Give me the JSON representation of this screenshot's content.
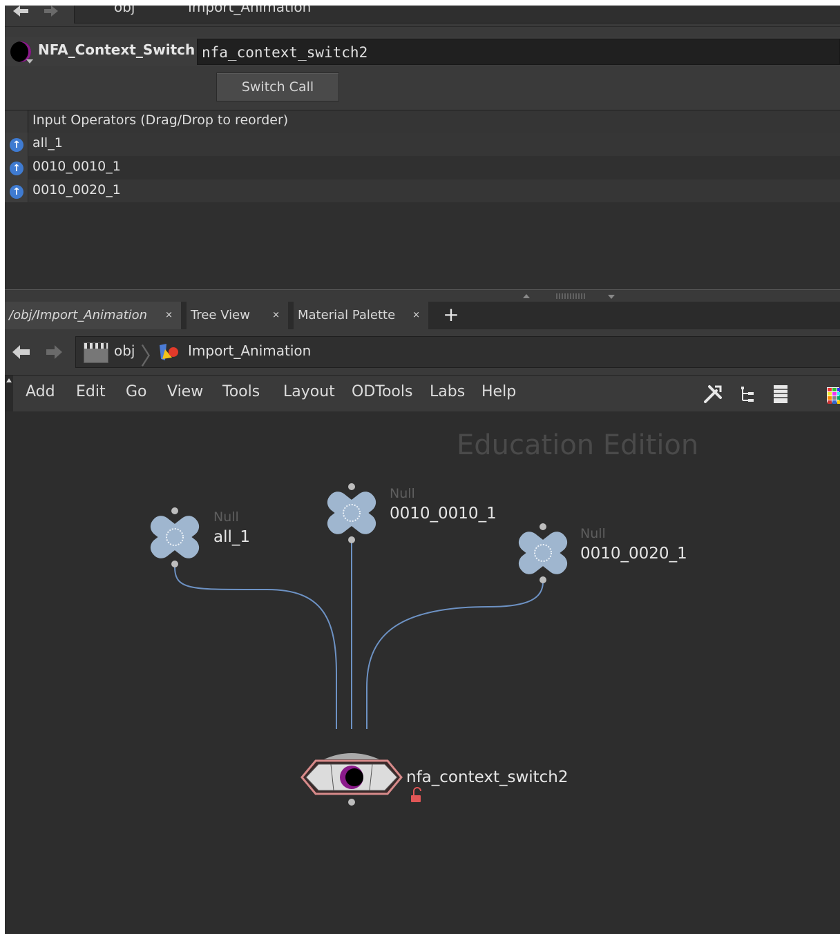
{
  "top_path": {
    "obj": "obj",
    "current": "Import_Animation"
  },
  "node_header": {
    "type_label": "NFA_Context_Switch",
    "name_value": "nfa_context_switch2"
  },
  "buttons": {
    "switch_call": "Switch Call"
  },
  "input_operators": {
    "header": "Input Operators (Drag/Drop to reorder)",
    "rows": [
      "all_1",
      "0010_0010_1",
      "0010_0020_1"
    ]
  },
  "tabs": [
    {
      "label": "/obj/Import_Animation",
      "close": "×"
    },
    {
      "label": "Tree View",
      "close": "×"
    },
    {
      "label": "Material Palette",
      "close": "×"
    }
  ],
  "tab_add": "+",
  "path_bar": {
    "obj": "obj",
    "current": "Import_Animation",
    "icons": [
      "obj-icon",
      "animation-icon"
    ]
  },
  "menu": [
    "Add",
    "Edit",
    "Go",
    "View",
    "Tools",
    "Layout",
    "ODTools",
    "Labs",
    "Help"
  ],
  "toolbar_icons": [
    "tools-icon",
    "tree-icon",
    "list-icon",
    "color-palette-icon"
  ],
  "network": {
    "watermark": "Education Edition",
    "nodes": [
      {
        "type": "Null",
        "name": "all_1"
      },
      {
        "type": "Null",
        "name": "0010_0010_1"
      },
      {
        "type": "Null",
        "name": "0010_0020_1"
      },
      {
        "type": "",
        "name": "nfa_context_switch2",
        "locked": true
      }
    ]
  },
  "colors": {
    "wire": "#6d92c4",
    "null_node": "#9fb6cf",
    "switch_node_outline": "#d78a8a",
    "accent_purple": "#8a1a8a"
  }
}
